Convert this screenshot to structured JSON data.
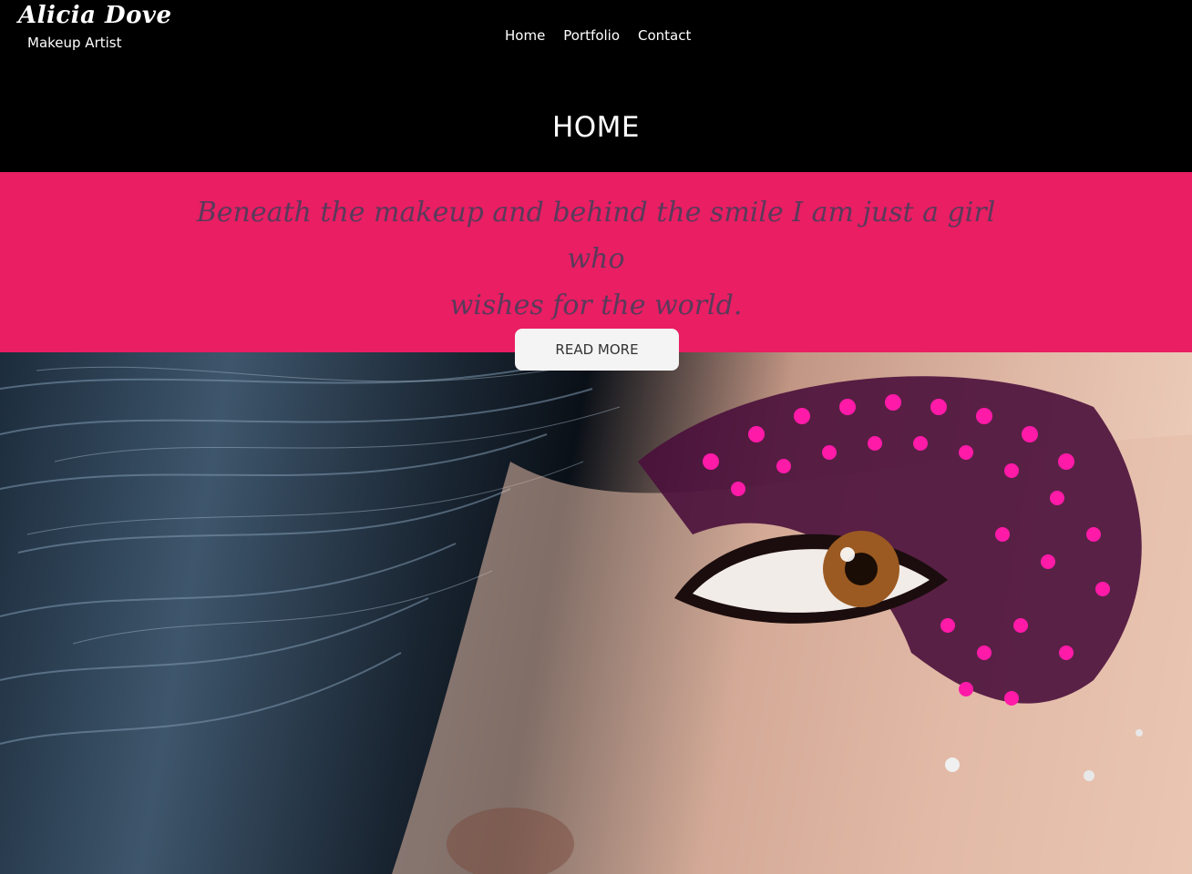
{
  "brand": {
    "name": "Alicia Dove",
    "subtitle": "Makeup Artist"
  },
  "nav": {
    "items": [
      {
        "label": "Home"
      },
      {
        "label": "Portfolio"
      },
      {
        "label": "Contact"
      }
    ]
  },
  "page": {
    "title": "HOME"
  },
  "hero": {
    "quote_line1": "Beneath the makeup and behind the smile I am just a girl who",
    "quote_line2": "wishes for the world.",
    "button_label": "READ MORE",
    "image_subject": "close-up of eye with pink feather lashes and dark hair"
  },
  "colors": {
    "header_bg": "#000000",
    "accent": "#e91e63",
    "quote_text": "#5a3a5a",
    "button_bg": "#f4f4f4"
  }
}
